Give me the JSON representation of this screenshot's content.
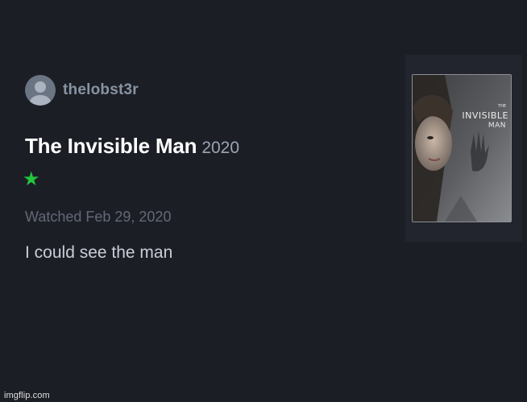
{
  "review": {
    "username": "thelobst3r",
    "film_title": "The Invisible Man",
    "film_year": "2020",
    "rating_stars": 1,
    "rating_display": "★",
    "watched_text": "Watched Feb 29, 2020",
    "review_text": "I could see the man"
  },
  "poster": {
    "title_small": "THE",
    "title_main": "INVISIBLE",
    "title_sub": "MAN"
  },
  "watermark": "imgflip.com",
  "colors": {
    "background": "#1c1e26",
    "star_green": "#22c53a",
    "username": "#8893a2",
    "title": "#ffffff"
  },
  "icons": {
    "avatar": "user-silhouette-icon",
    "star": "star-icon"
  }
}
